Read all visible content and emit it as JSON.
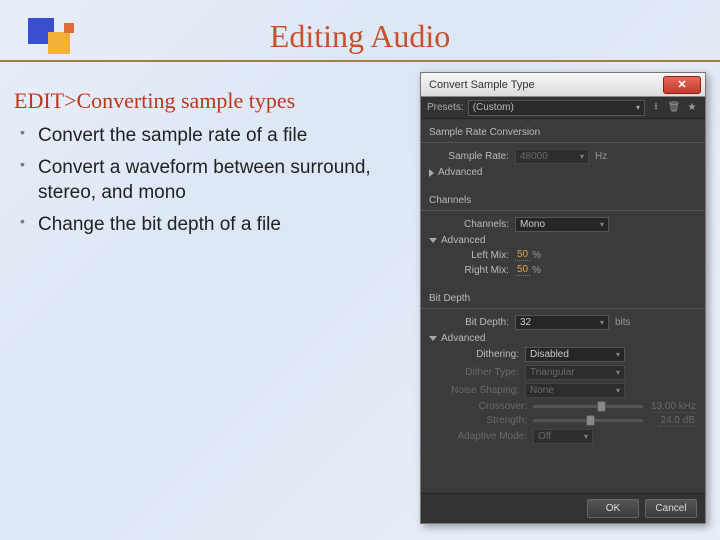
{
  "slide": {
    "title": "Editing Audio",
    "heading": "EDIT>Converting sample types",
    "bullets": [
      "Convert the sample rate of a file",
      "Convert a waveform between surround, stereo, and mono",
      "Change the bit depth of a file"
    ]
  },
  "dialog": {
    "title": "Convert Sample Type",
    "presets": {
      "label": "Presets:",
      "value": "(Custom)"
    },
    "sample_rate_section": {
      "title": "Sample Rate Conversion",
      "sample_rate_label": "Sample Rate:",
      "sample_rate_value": "48000",
      "sample_rate_unit": "Hz",
      "advanced_label": "Advanced"
    },
    "channels_section": {
      "title": "Channels",
      "channels_label": "Channels:",
      "channels_value": "Mono",
      "advanced_label": "Advanced",
      "left_mix_label": "Left Mix:",
      "left_mix_value": "50",
      "left_mix_unit": "%",
      "right_mix_label": "Right Mix:",
      "right_mix_value": "50",
      "right_mix_unit": "%"
    },
    "bitdepth_section": {
      "title": "Bit Depth",
      "bitdepth_label": "Bit Depth:",
      "bitdepth_value": "32",
      "bitdepth_unit": "bits",
      "advanced_label": "Advanced",
      "dithering_label": "Dithering:",
      "dithering_value": "Disabled",
      "dither_type_label": "Dither Type:",
      "dither_type_value": "Triangular",
      "noise_shaping_label": "Noise Shaping:",
      "noise_shaping_value": "None",
      "crossover_label": "Crossover:",
      "crossover_value": "13.00 kHz",
      "strength_label": "Strength:",
      "strength_value": "24.0 dB",
      "adaptive_mode_label": "Adaptive Mode:",
      "adaptive_mode_value": "Off"
    },
    "buttons": {
      "ok": "OK",
      "cancel": "Cancel"
    }
  }
}
